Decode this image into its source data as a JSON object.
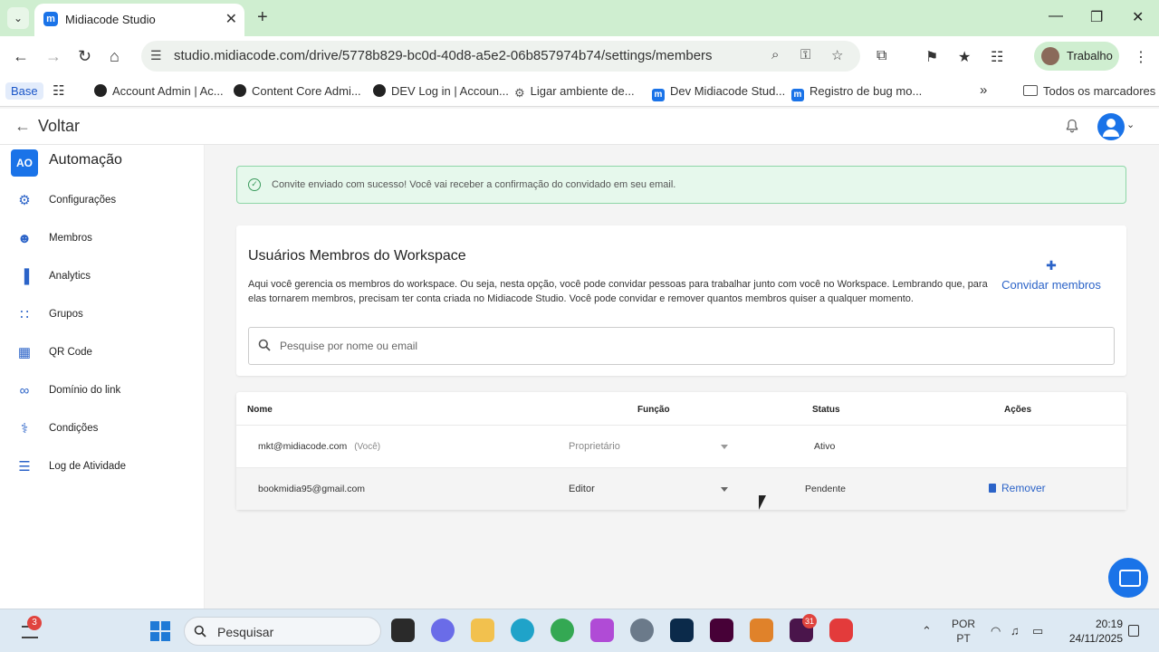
{
  "browser": {
    "tab_title": "Midiacode Studio",
    "tab_favicon_letter": "m",
    "url": "studio.midiacode.com/drive/5778b829-bc0d-40d8-a5e2-06b857974b74/settings/members",
    "profile_name": "Trabalho",
    "bookmarks": [
      {
        "label": "Base",
        "icon": "none"
      },
      {
        "label": "Account Admin | Ac...",
        "icon": "globe-icon"
      },
      {
        "label": "Content Core Admi...",
        "icon": "globe-icon"
      },
      {
        "label": "DEV Log in | Accoun...",
        "icon": "globe-icon"
      },
      {
        "label": "Ligar ambiente de...",
        "icon": "gear-icon"
      },
      {
        "label": "Dev Midiacode Stud...",
        "icon": "midiacode-icon"
      },
      {
        "label": "Registro de bug mo...",
        "icon": "midiacode-icon"
      }
    ],
    "all_bookmarks_label": "Todos os marcadores"
  },
  "header": {
    "back_label": "Voltar"
  },
  "sidebar": {
    "workspace_initials": "AO",
    "workspace_name": "Automação",
    "items": [
      {
        "label": "Configurações",
        "icon": "gear-icon"
      },
      {
        "label": "Membros",
        "icon": "people-icon"
      },
      {
        "label": "Analytics",
        "icon": "bar-chart-icon"
      },
      {
        "label": "Grupos",
        "icon": "groups-icon"
      },
      {
        "label": "QR Code",
        "icon": "qr-code-icon"
      },
      {
        "label": "Domínio do link",
        "icon": "link-icon"
      },
      {
        "label": "Condições",
        "icon": "conditions-icon"
      },
      {
        "label": "Log de Atividade",
        "icon": "list-icon"
      }
    ]
  },
  "alert": {
    "message": "Convite enviado com sucesso! Você vai receber a confirmação do convidado em seu email."
  },
  "members_card": {
    "title": "Usuários Membros do Workspace",
    "description": "Aqui você gerencia os membros do workspace. Ou seja, nesta opção, você pode convidar pessoas para trabalhar junto com você no Workspace. Lembrando que, para elas tornarem membros, precisam ter conta criada no Midiacode Studio. Você pode convidar e remover quantos membros quiser a qualquer momento.",
    "invite_label": "Convidar membros",
    "search_placeholder": "Pesquise por nome ou email"
  },
  "table": {
    "headers": {
      "name": "Nome",
      "role": "Função",
      "status": "Status",
      "actions": "Ações"
    },
    "rows": [
      {
        "email": "mkt@midiacode.com",
        "you": "(Você)",
        "role": "Proprietário",
        "status": "Ativo",
        "action": ""
      },
      {
        "email": "bookmidia95@gmail.com",
        "you": "",
        "role": "Editor",
        "status": "Pendente",
        "action": "Remover"
      }
    ]
  },
  "taskbar": {
    "widget_badge": "3",
    "search_label": "Pesquisar",
    "slack_badge": "31",
    "lang_line1": "POR",
    "lang_line2": "PT",
    "time": "20:19",
    "date": "24/11/2025"
  },
  "colors": {
    "accent": "#1a73e8",
    "link": "#2b63c8",
    "success_bg": "#e6f8ec",
    "success_border": "#8ed6a7",
    "tabbar": "#cfeed0"
  }
}
